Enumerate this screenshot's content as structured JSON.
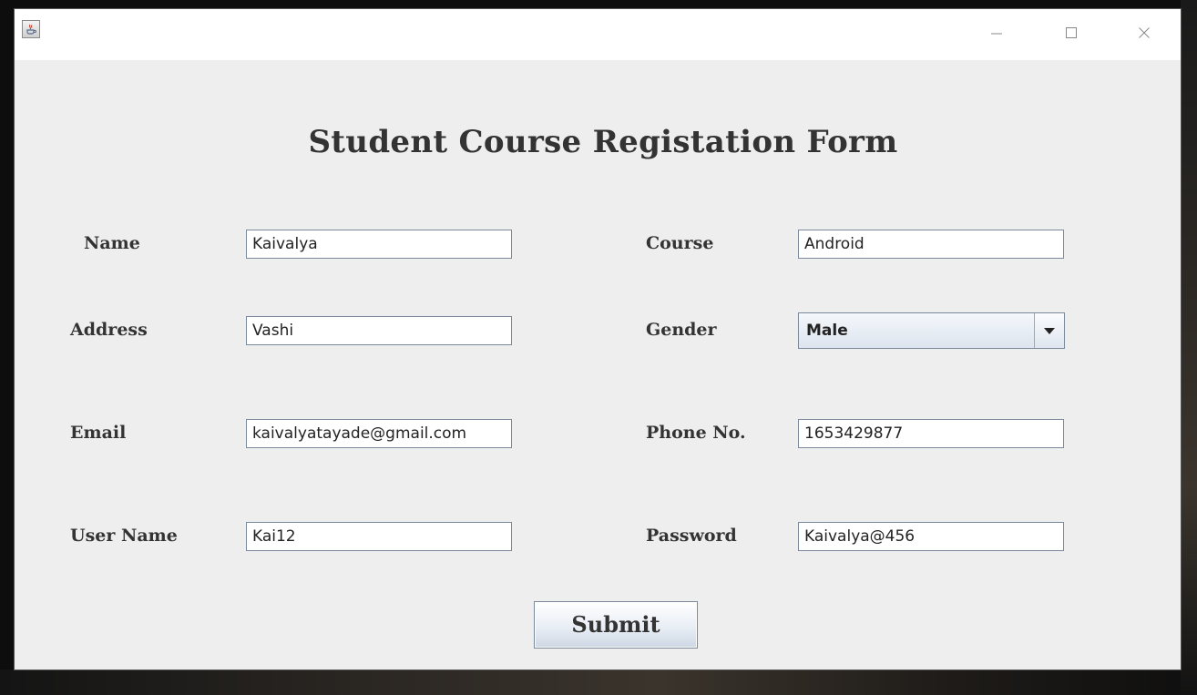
{
  "window": {
    "app_icon": "java-cup-icon",
    "controls": {
      "minimize": "minimize-icon",
      "maximize": "maximize-icon",
      "close": "close-icon"
    }
  },
  "form": {
    "title": "Student Course Registation Form",
    "fields": {
      "name": {
        "label": "Name",
        "value": "Kaivalya"
      },
      "course": {
        "label": "Course",
        "value": "Android"
      },
      "address": {
        "label": "Address",
        "value": "Vashi"
      },
      "gender": {
        "label": "Gender",
        "value": "Male"
      },
      "email": {
        "label": "Email",
        "value": "kaivalyatayade@gmail.com"
      },
      "phone": {
        "label": "Phone No.",
        "value": "1653429877"
      },
      "username": {
        "label": "User Name",
        "value": "Kai12"
      },
      "password": {
        "label": "Password",
        "value": "Kaivalya@456"
      }
    },
    "submit_label": "Submit"
  },
  "colors": {
    "background": "#eeeeee",
    "text": "#333333",
    "field_border": "#7a8a9c"
  }
}
